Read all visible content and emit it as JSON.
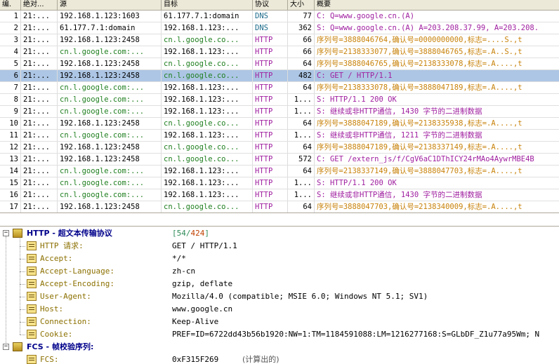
{
  "columns": [
    "编.",
    "绝对...",
    "源",
    "目标",
    "协议",
    "大小",
    "概要"
  ],
  "rows": [
    {
      "no": "1",
      "time": "21:...",
      "src": "192.168.1.123:1603",
      "dst": "61.177.7.1:domain",
      "proto": "DNS",
      "size": "77",
      "summary": "C: Q=www.google.cn.(A)",
      "sc": "black",
      "dc": "black",
      "pc": "dns",
      "mc": "purple"
    },
    {
      "no": "2",
      "time": "21:...",
      "src": "61.177.7.1:domain",
      "dst": "192.168.1.123:...",
      "proto": "DNS",
      "size": "362",
      "summary": "S: Q=www.google.cn.(A) A=203.208.37.99, A=203.208.",
      "sc": "black",
      "dc": "black",
      "pc": "dns",
      "mc": "purple"
    },
    {
      "no": "3",
      "time": "21:...",
      "src": "192.168.1.123:2458",
      "dst": "cn.l.google.co...",
      "proto": "HTTP",
      "size": "66",
      "summary": "序列号=3888046764,确认号=0000000000,标志=....S.,t",
      "sc": "black",
      "dc": "green",
      "pc": "purple",
      "mc": "orange"
    },
    {
      "no": "4",
      "time": "21:...",
      "src": "cn.l.google.com:...",
      "dst": "192.168.1.123:...",
      "proto": "HTTP",
      "size": "66",
      "summary": "序列号=2138333077,确认号=3888046765,标志=.A..S.,t",
      "sc": "green",
      "dc": "black",
      "pc": "purple",
      "mc": "orange"
    },
    {
      "no": "5",
      "time": "21:...",
      "src": "192.168.1.123:2458",
      "dst": "cn.l.google.co...",
      "proto": "HTTP",
      "size": "64",
      "summary": "序列号=3888046765,确认号=2138333078,标志=.A....,t",
      "sc": "black",
      "dc": "green",
      "pc": "purple",
      "mc": "orange"
    },
    {
      "no": "6",
      "time": "21:...",
      "src": "192.168.1.123:2458",
      "dst": "cn.l.google.co...",
      "proto": "HTTP",
      "size": "482",
      "summary": "C: GET / HTTP/1.1",
      "sc": "black",
      "dc": "green",
      "pc": "purple",
      "mc": "purple",
      "sel": true
    },
    {
      "no": "7",
      "time": "21:...",
      "src": "cn.l.google.com:...",
      "dst": "192.168.1.123:...",
      "proto": "HTTP",
      "size": "64",
      "summary": "序列号=2138333078,确认号=3888047189,标志=.A....,t",
      "sc": "green",
      "dc": "black",
      "pc": "purple",
      "mc": "orange"
    },
    {
      "no": "8",
      "time": "21:...",
      "src": "cn.l.google.com:...",
      "dst": "192.168.1.123:...",
      "proto": "HTTP",
      "size": "1...",
      "summary": "S: HTTP/1.1 200 OK",
      "sc": "green",
      "dc": "black",
      "pc": "purple",
      "mc": "purple"
    },
    {
      "no": "9",
      "time": "21:...",
      "src": "cn.l.google.com:...",
      "dst": "192.168.1.123:...",
      "proto": "HTTP",
      "size": "1...",
      "summary": "S: 继续或非HTTP通信, 1430 字节的二进制数据",
      "sc": "green",
      "dc": "black",
      "pc": "purple",
      "mc": "purple"
    },
    {
      "no": "10",
      "time": "21:...",
      "src": "192.168.1.123:2458",
      "dst": "cn.l.google.co...",
      "proto": "HTTP",
      "size": "64",
      "summary": "序列号=3888047189,确认号=2138335938,标志=.A....,t",
      "sc": "black",
      "dc": "green",
      "pc": "purple",
      "mc": "orange"
    },
    {
      "no": "11",
      "time": "21:...",
      "src": "cn.l.google.com:...",
      "dst": "192.168.1.123:...",
      "proto": "HTTP",
      "size": "1...",
      "summary": "S: 继续或非HTTP通信, 1211 字节的二进制数据",
      "sc": "green",
      "dc": "black",
      "pc": "purple",
      "mc": "purple"
    },
    {
      "no": "12",
      "time": "21:...",
      "src": "192.168.1.123:2458",
      "dst": "cn.l.google.co...",
      "proto": "HTTP",
      "size": "64",
      "summary": "序列号=3888047189,确认号=2138337149,标志=.A....,t",
      "sc": "black",
      "dc": "green",
      "pc": "purple",
      "mc": "orange"
    },
    {
      "no": "13",
      "time": "21:...",
      "src": "192.168.1.123:2458",
      "dst": "cn.l.google.co...",
      "proto": "HTTP",
      "size": "572",
      "summary": "C: GET /extern_js/f/CgV6aC1DThICY24rMAo4AywrMBE4B",
      "sc": "black",
      "dc": "green",
      "pc": "purple",
      "mc": "purple"
    },
    {
      "no": "14",
      "time": "21:...",
      "src": "cn.l.google.com:...",
      "dst": "192.168.1.123:...",
      "proto": "HTTP",
      "size": "64",
      "summary": "序列号=2138337149,确认号=3888047703,标志=.A....,t",
      "sc": "green",
      "dc": "black",
      "pc": "purple",
      "mc": "orange"
    },
    {
      "no": "15",
      "time": "21:...",
      "src": "cn.l.google.com:...",
      "dst": "192.168.1.123:...",
      "proto": "HTTP",
      "size": "1...",
      "summary": "S: HTTP/1.1 200 OK",
      "sc": "green",
      "dc": "black",
      "pc": "purple",
      "mc": "purple"
    },
    {
      "no": "16",
      "time": "21:...",
      "src": "cn.l.google.com:...",
      "dst": "192.168.1.123:...",
      "proto": "HTTP",
      "size": "1...",
      "summary": "S: 继续或非HTTP通信, 1430 字节的二进制数据",
      "sc": "green",
      "dc": "black",
      "pc": "purple",
      "mc": "purple"
    },
    {
      "no": "17",
      "time": "21:...",
      "src": "192.168.1.123:2458",
      "dst": "cn.l.google.co...",
      "proto": "HTTP",
      "size": "64",
      "summary": "序列号=3888047703,确认号=2138340009,标志=.A....,t",
      "sc": "black",
      "dc": "green",
      "pc": "purple",
      "mc": "orange"
    }
  ],
  "detail": {
    "http": {
      "title": "HTTP - 超文本传输协议",
      "range_open": "[",
      "range_a": "54",
      "range_sep": "/",
      "range_b": "424",
      "range_close": "]",
      "fields": [
        {
          "name": "HTTP 请求:",
          "value": "GET / HTTP/1.1"
        },
        {
          "name": "Accept:",
          "value": "*/*"
        },
        {
          "name": "Accept-Language:",
          "value": "zh-cn"
        },
        {
          "name": "Accept-Encoding:",
          "value": "gzip, deflate"
        },
        {
          "name": "User-Agent:",
          "value": "Mozilla/4.0 (compatible; MSIE 6.0; Windows NT 5.1; SV1)"
        },
        {
          "name": "Host:",
          "value": "www.google.cn"
        },
        {
          "name": "Connection:",
          "value": "Keep-Alive"
        },
        {
          "name": "Cookie:",
          "value": "PREF=ID=6722dd43b56b1920:NW=1:TM=1184591088:LM=1216277168:S=GLbDF_Z1u77a95Wm; N"
        }
      ]
    },
    "fcs": {
      "title": "FCS - 帧校验序列:",
      "fields": [
        {
          "name": "FCS:",
          "value": "0xF315F269",
          "note": "(计算出的)"
        }
      ]
    }
  },
  "colors": {
    "selected_row": "#adc6e5",
    "green": "#1f7f1f",
    "purple": "#a020a0",
    "orange": "#c8820a"
  }
}
